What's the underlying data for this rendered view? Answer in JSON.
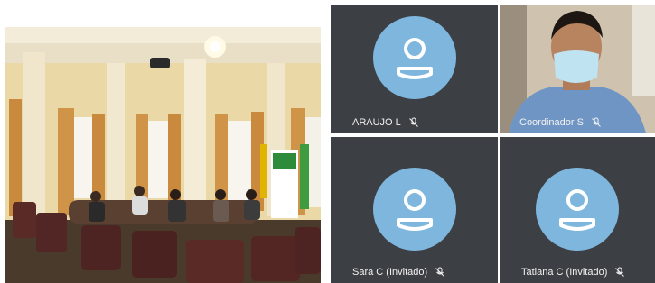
{
  "call": {
    "participants": [
      {
        "name": "ARAUJO L",
        "avatar_icon": "person-icon",
        "status_icon": "mic-off-icon",
        "video": false
      },
      {
        "name": "Coordinador S",
        "avatar_icon": "",
        "status_icon": "mic-off-icon",
        "video": true
      },
      {
        "name": "Sara C (Invitado)",
        "avatar_icon": "person-icon",
        "status_icon": "mic-off-icon",
        "video": false
      },
      {
        "name": "Tatiana C (Invitado)",
        "avatar_icon": "person-icon",
        "status_icon": "mic-off-icon",
        "video": false
      }
    ],
    "colors": {
      "tile_bg": "#3c3f43",
      "avatar_bg": "#7fb6dd",
      "label_text": "#f2f2f2"
    }
  }
}
